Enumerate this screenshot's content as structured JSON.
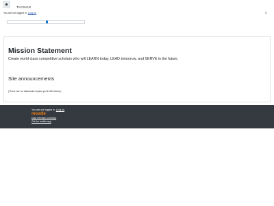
{
  "navbar": {
    "site_name": "TACSVLE",
    "drawer_icon": "hamburger-icon"
  },
  "header": {
    "not_logged_in": "You are not logged in.",
    "login_link": "(Log in)",
    "right_marker": "S"
  },
  "main": {
    "mission_title": "Mission Statement",
    "mission_text": "Create world class competitive scholars who will LEARN today, LEAD tomorrow, and SERVE in the future.",
    "announcements_title": "Site announcements",
    "announcements_empty": "(There are no discussion topics yet in this forum)"
  },
  "footer": {
    "not_logged_in": "You are not logged in.",
    "login_link": "(Log in)",
    "logo_text": "moodle",
    "data_retention": "Data retention summary",
    "mobile_app": "Get the mobile app"
  },
  "colors": {
    "link": "#0f47ad",
    "footer_bg": "#343a40",
    "moodle_orange": "#f98012"
  }
}
